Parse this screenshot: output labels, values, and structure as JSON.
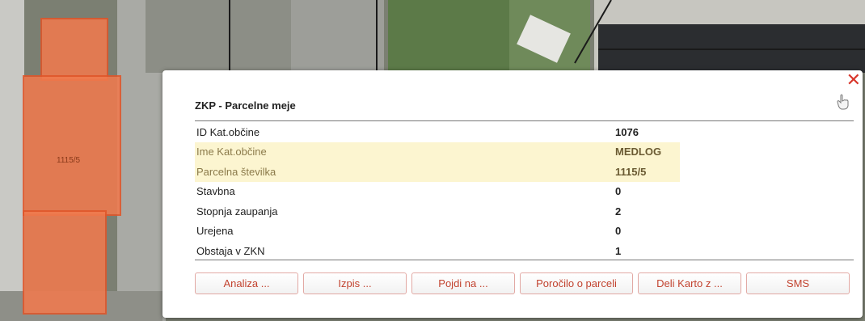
{
  "popup": {
    "title": "ZKP - Parcelne meje",
    "close_icon": "close-icon",
    "pin_icon": "hand-pointer-icon",
    "accent_color": "#d8352a",
    "highlight_color": "#fcf5d0",
    "rows": [
      {
        "label": "ID Kat.občine",
        "value": "1076",
        "highlight": false
      },
      {
        "label": "Ime Kat.občine",
        "value": "MEDLOG",
        "highlight": true
      },
      {
        "label": "Parcelna številka",
        "value": "1115/5",
        "highlight": true
      },
      {
        "label": "Stavbna",
        "value": "0",
        "highlight": false
      },
      {
        "label": "Stopnja zaupanja",
        "value": "2",
        "highlight": false
      },
      {
        "label": "Urejena",
        "value": "0",
        "highlight": false
      },
      {
        "label": "Obstaja v ZKN",
        "value": "1",
        "highlight": false
      }
    ],
    "buttons": {
      "analiza": "Analiza ...",
      "izpis": "Izpis ...",
      "pojdi": "Pojdi na ...",
      "porocilo": "Poročilo o parceli",
      "deli": "Deli Karto z ...",
      "sms": "SMS"
    }
  },
  "map": {
    "parcel_label": "1115/5",
    "parcel_color": "#f07a4e"
  }
}
